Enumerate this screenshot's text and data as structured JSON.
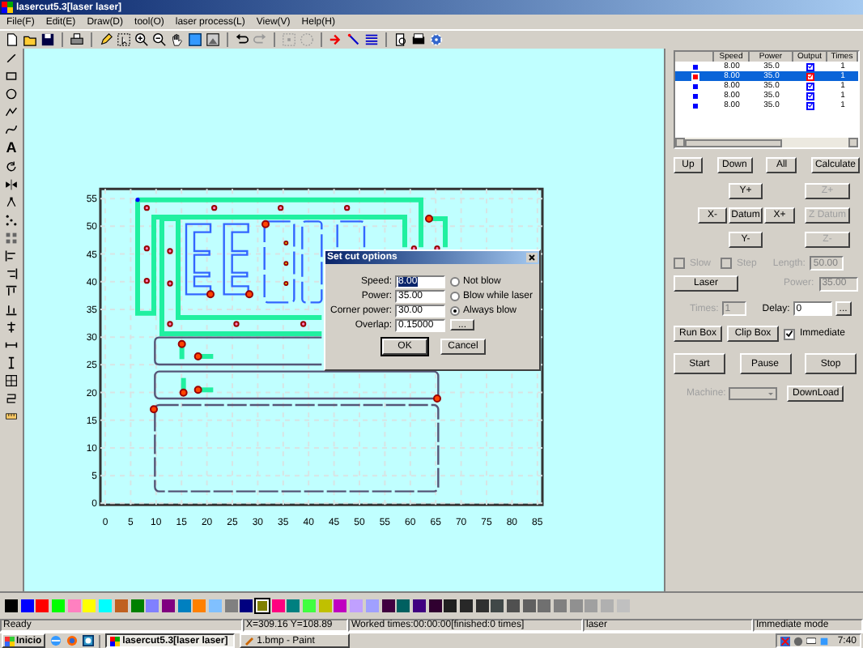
{
  "window": {
    "title": "lasercut5.3[laser laser]"
  },
  "menu": [
    "File(F)",
    "Edit(E)",
    "Draw(D)",
    "tool(O)",
    "laser process(L)",
    "View(V)",
    "Help(H)"
  ],
  "left_tools": {
    "text_tool_glyph": "A"
  },
  "canvas": {
    "x_ticks": [
      "0",
      "5",
      "10",
      "15",
      "20",
      "25",
      "30",
      "35",
      "40",
      "45",
      "50",
      "55",
      "60",
      "65",
      "70",
      "75",
      "80",
      "85"
    ],
    "y_ticks": [
      "55",
      "50",
      "45",
      "40",
      "35",
      "30",
      "25",
      "20",
      "15",
      "10",
      "5",
      "0"
    ]
  },
  "dialog": {
    "title": "Set cut options",
    "fields": [
      {
        "label": "Speed:",
        "value": "8.00",
        "selected": true
      },
      {
        "label": "Power:",
        "value": "35.00",
        "selected": false
      },
      {
        "label": "Corner power:",
        "value": "30.00",
        "selected": false
      },
      {
        "label": "Overlap:",
        "value": "0.15000",
        "selected": false
      }
    ],
    "blow_options": [
      {
        "label": "Not blow",
        "selected": false
      },
      {
        "label": "Blow while laser",
        "selected": false
      },
      {
        "label": "Always blow",
        "selected": true
      }
    ],
    "browse_button": "...",
    "buttons": [
      "OK",
      "Cancel"
    ]
  },
  "layers": {
    "columns": [
      "Speed",
      "Power",
      "Output",
      "Times"
    ],
    "rows": [
      {
        "color": "#0000ff",
        "speed": "8.00",
        "power": "35.0",
        "output": true,
        "times": "1",
        "selected": false
      },
      {
        "color": "#ff0000",
        "speed": "8.00",
        "power": "35.0",
        "output": true,
        "times": "1",
        "selected": true
      },
      {
        "color": "#0000ff",
        "speed": "8.00",
        "power": "35.0",
        "output": true,
        "times": "1",
        "selected": false
      },
      {
        "color": "#0000ff",
        "speed": "8.00",
        "power": "35.0",
        "output": true,
        "times": "1",
        "selected": false
      },
      {
        "color": "#0000ff",
        "speed": "8.00",
        "power": "35.0",
        "output": true,
        "times": "1",
        "selected": false
      }
    ]
  },
  "order_buttons": [
    "Up",
    "Down",
    "All",
    "Calculate"
  ],
  "jog_buttons": [
    {
      "label": "Y+",
      "disabled": false
    },
    {
      "label": "X-",
      "disabled": false
    },
    {
      "label": "Datum",
      "disabled": false
    },
    {
      "label": "X+",
      "disabled": false
    },
    {
      "label": "Y-",
      "disabled": false
    },
    {
      "label": "Z+",
      "disabled": true
    },
    {
      "label": "Z Datum",
      "disabled": true
    },
    {
      "label": "Z-",
      "disabled": true
    }
  ],
  "slow": {
    "label": "Slow",
    "checked": false,
    "disabled": true
  },
  "step": {
    "label": "Step",
    "checked": false,
    "disabled": true
  },
  "length": {
    "label": "Length:",
    "value": "50.00",
    "disabled": true
  },
  "laser_button": "Laser",
  "power": {
    "label": "Power:",
    "value": "35.00",
    "disabled": true
  },
  "times": {
    "label": "Times:",
    "value": "1",
    "disabled": true
  },
  "delay": {
    "label": "Delay:",
    "value": "0"
  },
  "delay_button": "...",
  "run_box_button": "Run Box",
  "clip_box_button": "Clip Box",
  "immediate": {
    "label": "Immediate",
    "checked": true
  },
  "run_buttons": [
    "Start",
    "Pause",
    "Stop"
  ],
  "machine": {
    "label": "Machine:",
    "disabled": true
  },
  "download_button": "DownLoad",
  "palette": [
    {
      "color": "#000000",
      "selected": false
    },
    {
      "color": "#0000ff",
      "selected": false
    },
    {
      "color": "#ff0000",
      "selected": false
    },
    {
      "color": "#00ff00",
      "selected": false
    },
    {
      "color": "#ff80c0",
      "selected": false
    },
    {
      "color": "#ffff00",
      "selected": false
    },
    {
      "color": "#00ffff",
      "selected": false
    },
    {
      "color": "#c06020",
      "selected": false
    },
    {
      "color": "#008000",
      "selected": false
    },
    {
      "color": "#8080ff",
      "selected": false
    },
    {
      "color": "#800080",
      "selected": false
    },
    {
      "color": "#0080c0",
      "selected": false
    },
    {
      "color": "#ff8000",
      "selected": false
    },
    {
      "color": "#80c0ff",
      "selected": false
    },
    {
      "color": "#808080",
      "selected": false
    },
    {
      "color": "#000080",
      "selected": false
    },
    {
      "color": "#808000",
      "selected": true
    },
    {
      "color": "#ff0080",
      "selected": false
    },
    {
      "color": "#008080",
      "selected": false
    },
    {
      "color": "#40ff40",
      "selected": false
    },
    {
      "color": "#c0c000",
      "selected": false
    },
    {
      "color": "#c000c0",
      "selected": false
    },
    {
      "color": "#c0a0ff",
      "selected": false
    },
    {
      "color": "#a0a0ff",
      "selected": false
    },
    {
      "color": "#400040",
      "selected": false
    },
    {
      "color": "#006060",
      "selected": false
    },
    {
      "color": "#400080",
      "selected": false
    },
    {
      "color": "#300030",
      "selected": false
    },
    {
      "color": "#202020",
      "selected": false
    },
    {
      "color": "#282828",
      "selected": false
    },
    {
      "color": "#303030",
      "selected": false
    },
    {
      "color": "#404848",
      "selected": false
    },
    {
      "color": "#505050",
      "selected": false
    },
    {
      "color": "#606060",
      "selected": false
    },
    {
      "color": "#707070",
      "selected": false
    },
    {
      "color": "#808080",
      "selected": false
    },
    {
      "color": "#909090",
      "selected": false
    },
    {
      "color": "#a0a0a0",
      "selected": false
    },
    {
      "color": "#b0b0b0",
      "selected": false
    },
    {
      "color": "#c0c0c0",
      "selected": false
    }
  ],
  "status_bar": [
    "Ready",
    "X=309.16 Y=108.89",
    "Worked times:00:00:00[finished:0 times]",
    "laser",
    "Immediate mode"
  ],
  "taskbar": {
    "start": "Inicio",
    "tasks": [
      {
        "label": "lasercut5.3[laser laser]",
        "selected": true
      },
      {
        "label": "1.bmp - Paint",
        "selected": false
      }
    ],
    "clock": "7:40"
  }
}
